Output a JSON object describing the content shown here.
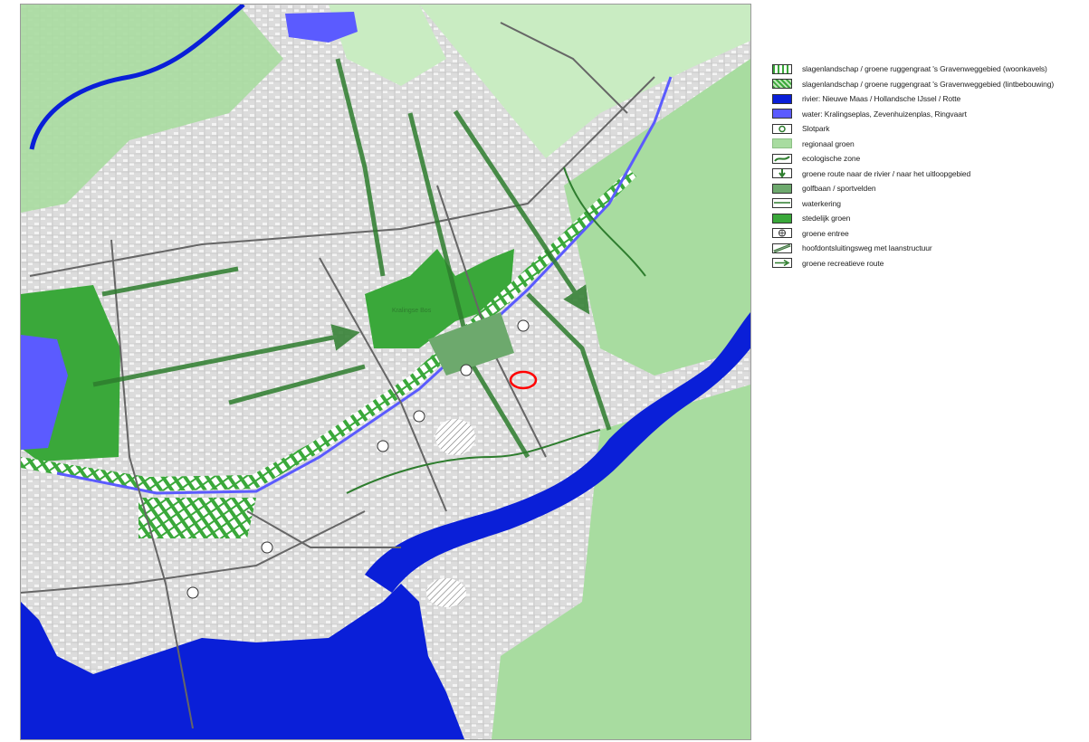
{
  "map": {
    "district_label": "Kralingse Bos",
    "colors": {
      "river": "#0a1fd8",
      "water": "#5b5bff",
      "regional_green": "#a8dca0",
      "urban_green": "#3aa83a",
      "dark_green": "#2e7d2e",
      "built": "#d8d8d8",
      "background": "#e9e9e9",
      "highlight": "#ff0000"
    }
  },
  "legend": {
    "items": [
      {
        "label": "slagenlandschap / groene ruggengraat 's Gravenweggebied (woonkavels)",
        "icon": "striped-green-plots-icon"
      },
      {
        "label": "slagenlandschap / groene ruggengraat 's Gravenweggebied (lintbebouwing)",
        "icon": "hatched-green-plots-icon"
      },
      {
        "label": "rivier: Nieuwe Maas / Hollandsche IJssel / Rotte",
        "icon": "river-swatch-icon"
      },
      {
        "label": "water: Kralingseplas, Zevenhuizenplas, Ringvaart",
        "icon": "water-swatch-icon"
      },
      {
        "label": "Slotpark",
        "icon": "slotpark-icon"
      },
      {
        "label": "regionaal groen",
        "icon": "regional-green-swatch-icon"
      },
      {
        "label": "ecologische zone",
        "icon": "ecological-zone-icon"
      },
      {
        "label": "groene route naar de rivier / naar het uitloopgebied",
        "icon": "green-route-arrow-icon"
      },
      {
        "label": "golfbaan / sportvelden",
        "icon": "golf-course-icon"
      },
      {
        "label": "waterkering",
        "icon": "dike-icon"
      },
      {
        "label": "stedelijk groen",
        "icon": "urban-green-swatch-icon"
      },
      {
        "label": "groene entree",
        "icon": "green-entrance-icon"
      },
      {
        "label": "hoofdontsluitingsweg met laanstructuur",
        "icon": "main-road-icon"
      },
      {
        "label": "groene recreatieve route",
        "icon": "recreation-route-arrow-icon"
      }
    ]
  }
}
